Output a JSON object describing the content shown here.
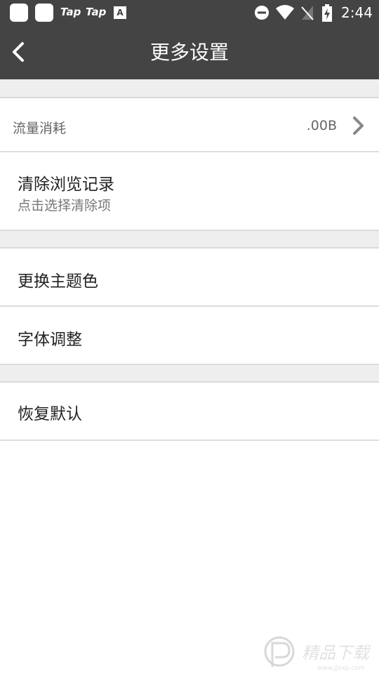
{
  "statusbar": {
    "tap1": "Tap",
    "tap2": "Tap",
    "time": "2:44"
  },
  "header": {
    "title": "更多设置"
  },
  "settings": {
    "traffic": {
      "label": "流量消耗",
      "value": ".00B"
    },
    "clear_history": {
      "label": "清除浏览记录",
      "sub": "点击选择清除项"
    },
    "theme_color": {
      "label": "更换主题色"
    },
    "font_adjust": {
      "label": "字体调整"
    },
    "restore_default": {
      "label": "恢复默认"
    }
  },
  "watermark": {
    "text": "精品下载",
    "url": "www.jjxxp.com"
  },
  "colors": {
    "bar": "#444444",
    "divider": "#dddddd",
    "gap": "#eeeeee"
  }
}
